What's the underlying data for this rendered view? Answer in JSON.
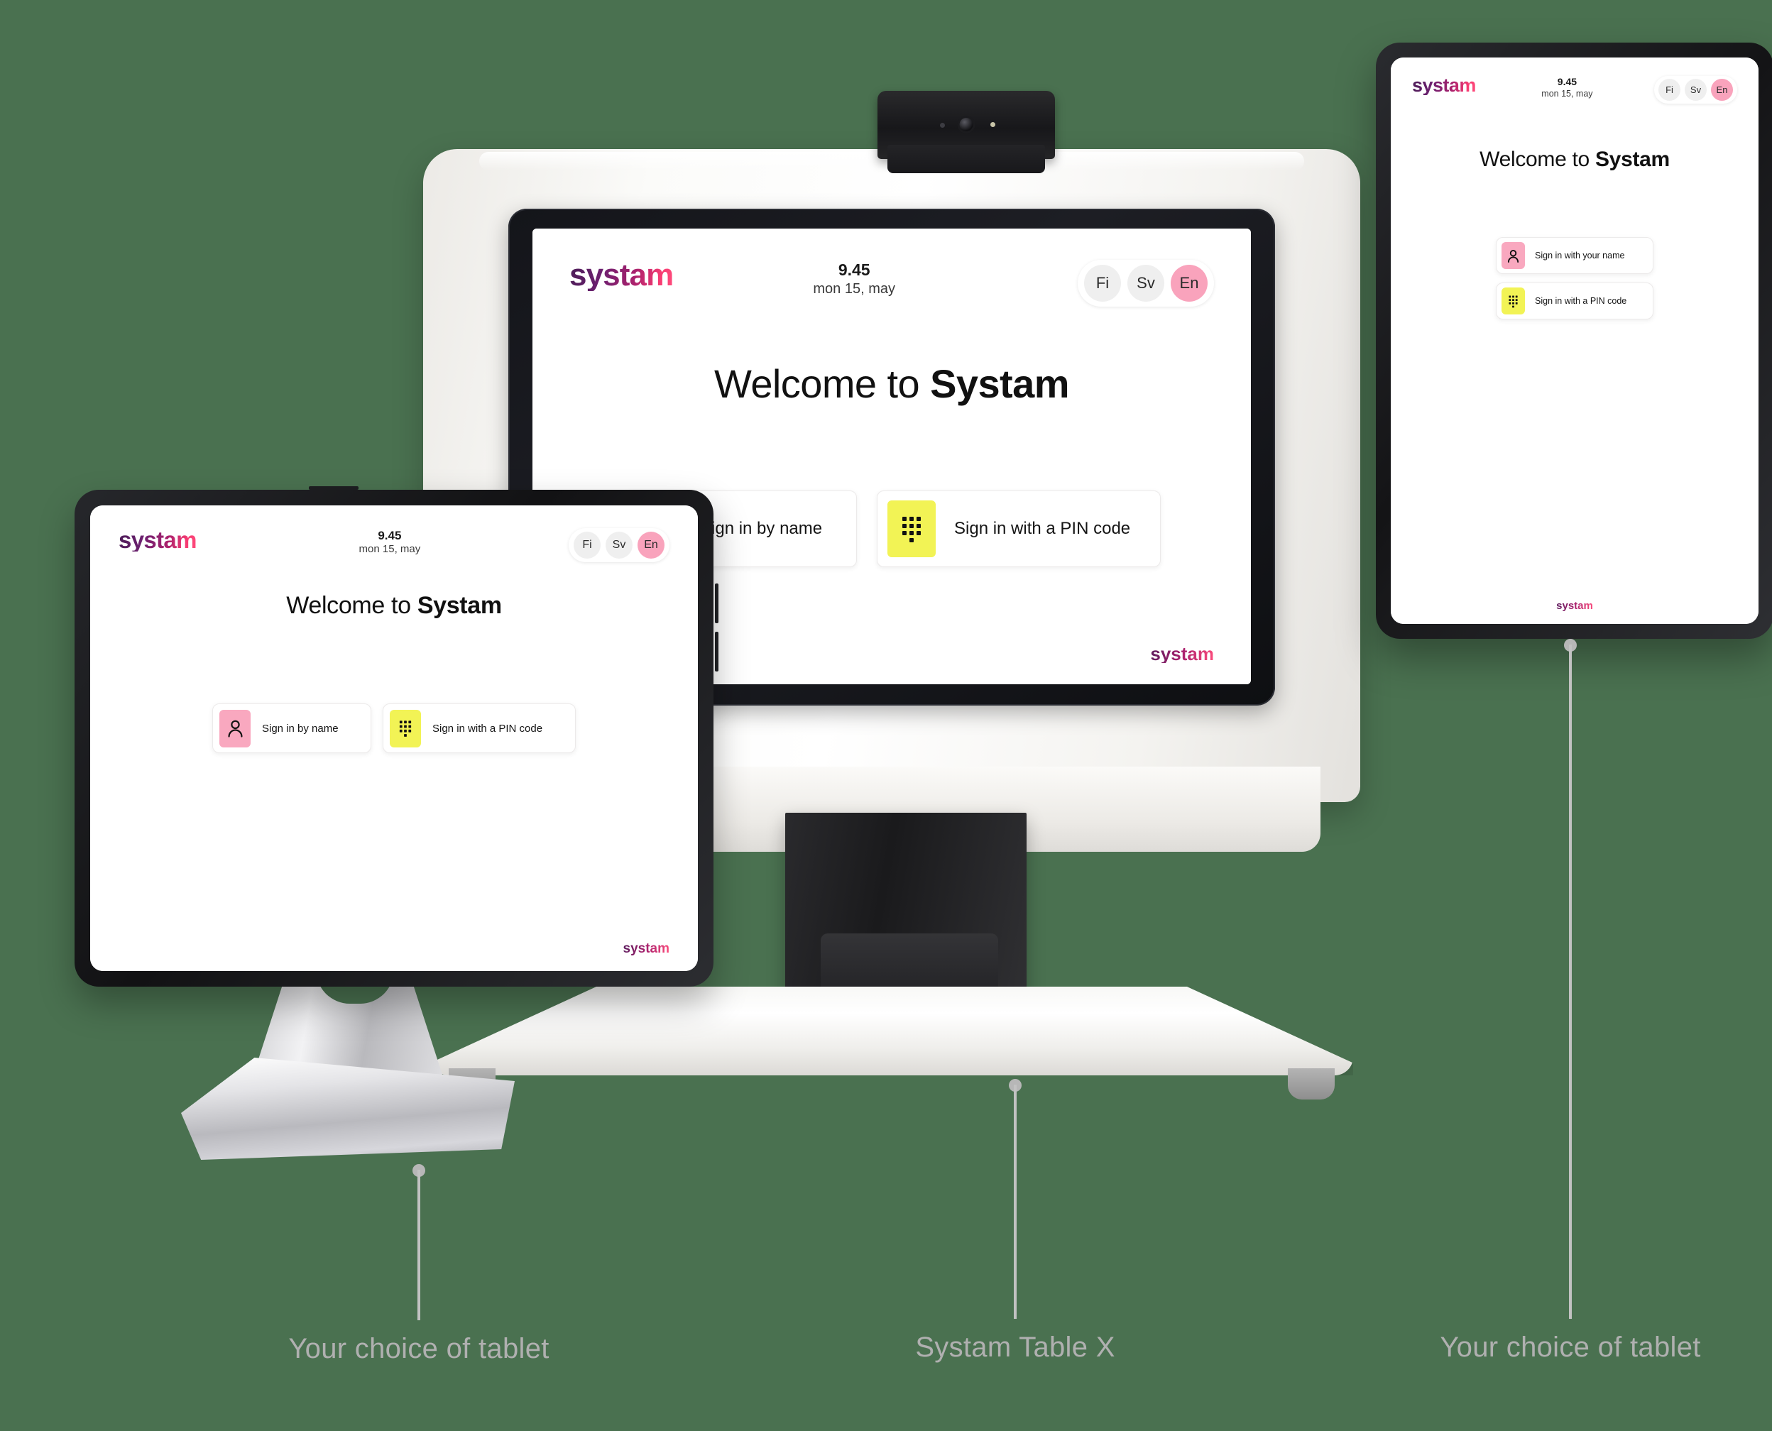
{
  "background_color": "#4a7150",
  "brand": {
    "name": "systam",
    "gradient_from": "#4b1d56",
    "gradient_to": "#ff4d7d"
  },
  "colors": {
    "accent_pink": "#f9a8bf",
    "accent_yellow": "#f2f355",
    "caption_gray": "#b0b0b0",
    "lang_active": "#f9a3bc"
  },
  "kiosk": {
    "caption": "Systam Table X",
    "screen": {
      "logo": "systam",
      "clock": {
        "time": "9.45",
        "date": "mon 15, may"
      },
      "languages": [
        {
          "code": "Fi",
          "active": false
        },
        {
          "code": "Sv",
          "active": false
        },
        {
          "code": "En",
          "active": true
        }
      ],
      "title_prefix": "Welcome to ",
      "title_brand": "Systam",
      "actions": [
        {
          "label": "Sign in by name",
          "icon": "person-icon",
          "swatch": "pink"
        },
        {
          "label": "Sign in with a PIN code",
          "icon": "keypad-icon",
          "swatch": "yellow"
        }
      ],
      "footer_logo": "systam"
    }
  },
  "tablet_left": {
    "caption": "Your choice of tablet",
    "screen": {
      "logo": "systam",
      "clock": {
        "time": "9.45",
        "date": "mon 15, may"
      },
      "languages": [
        {
          "code": "Fi",
          "active": false
        },
        {
          "code": "Sv",
          "active": false
        },
        {
          "code": "En",
          "active": true
        }
      ],
      "title_prefix": "Welcome to ",
      "title_brand": "Systam",
      "actions": [
        {
          "label": "Sign in by name",
          "icon": "person-icon",
          "swatch": "pink"
        },
        {
          "label": "Sign in with a PIN code",
          "icon": "keypad-icon",
          "swatch": "yellow"
        }
      ],
      "footer_logo": "systam"
    }
  },
  "tablet_right": {
    "caption": "Your choice of tablet",
    "screen": {
      "logo": "systam",
      "clock": {
        "time": "9.45",
        "date": "mon 15, may"
      },
      "languages": [
        {
          "code": "Fi",
          "active": false
        },
        {
          "code": "Sv",
          "active": false
        },
        {
          "code": "En",
          "active": true
        }
      ],
      "title_prefix": "Welcome to ",
      "title_brand": "Systam",
      "actions": [
        {
          "label": "Sign in with your name",
          "icon": "person-icon",
          "swatch": "pink"
        },
        {
          "label": "Sign in with a PIN code",
          "icon": "keypad-icon",
          "swatch": "yellow"
        }
      ],
      "footer_logo": "systam"
    }
  }
}
